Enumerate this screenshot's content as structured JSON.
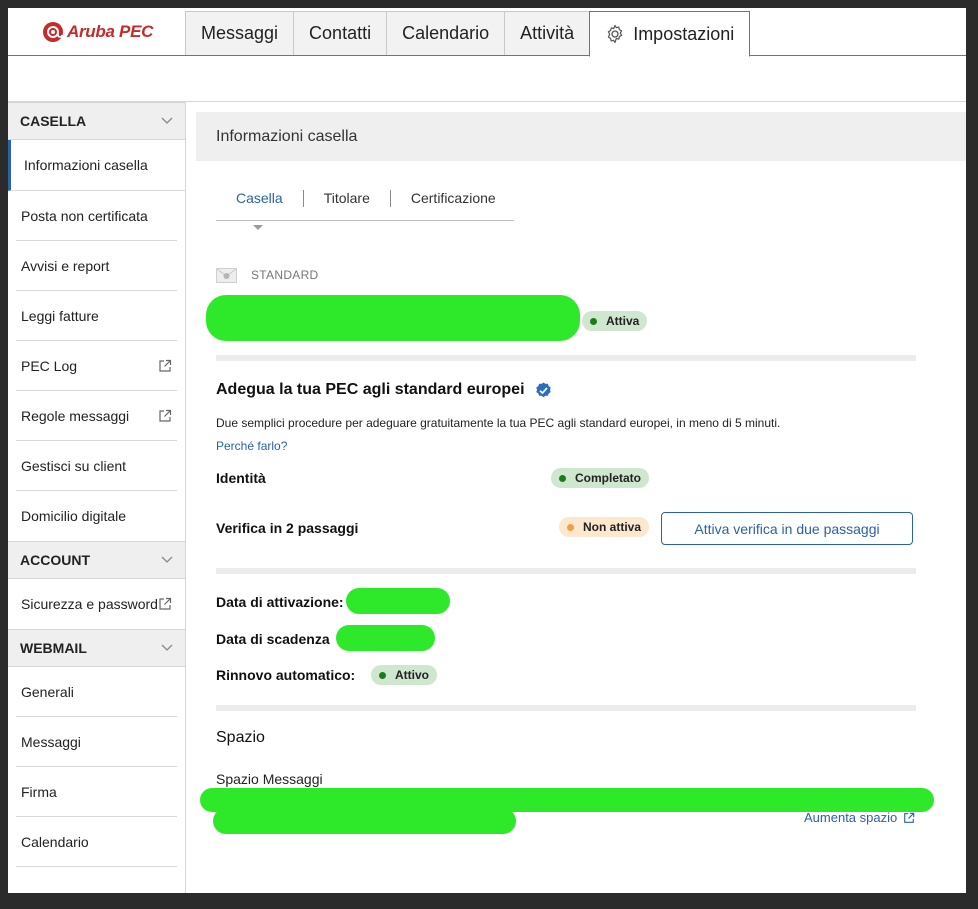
{
  "brand": {
    "name": "Aruba PEC"
  },
  "nav": {
    "tabs": [
      {
        "label": "Messaggi"
      },
      {
        "label": "Contatti"
      },
      {
        "label": "Calendario"
      },
      {
        "label": "Attività"
      },
      {
        "label": "Impostazioni",
        "icon": "gear-icon",
        "active": true
      }
    ]
  },
  "sidebar": {
    "casella": {
      "header": "CASELLA",
      "items": [
        {
          "label": "Informazioni casella",
          "active": true
        },
        {
          "label": "Posta non certificata"
        },
        {
          "label": "Avvisi e report"
        },
        {
          "label": "Leggi fatture"
        },
        {
          "label": "PEC Log",
          "icon": "external-link-icon"
        },
        {
          "label": "Regole messaggi",
          "icon": "external-link-icon"
        },
        {
          "label": "Gestisci su client"
        },
        {
          "label": "Domicilio digitale"
        }
      ]
    },
    "account": {
      "header": "ACCOUNT",
      "items": [
        {
          "label": "Sicurezza e password",
          "icon": "external-link-icon"
        }
      ]
    },
    "webmail": {
      "header": "WEBMAIL",
      "items": [
        {
          "label": "Generali"
        },
        {
          "label": "Messaggi"
        },
        {
          "label": "Firma"
        },
        {
          "label": "Calendario"
        }
      ]
    }
  },
  "main": {
    "header": "Informazioni casella",
    "subtabs": [
      {
        "label": "Casella",
        "active": true
      },
      {
        "label": "Titolare"
      },
      {
        "label": "Certificazione"
      }
    ],
    "mailbox_type": "STANDARD",
    "mailbox_status": "Attiva",
    "eu": {
      "title": "Adegua la tua PEC agli standard europei",
      "description": "Due semplici procedure per adeguare gratuitamente la tua PEC agli standard europei, in meno di 5 minuti.",
      "link": "Perché farlo?",
      "identity_label": "Identità",
      "identity_status": "Completato",
      "twofa_label": "Verifica in 2 passaggi",
      "twofa_status": "Non attiva",
      "twofa_button": "Attiva verifica in due passaggi"
    },
    "details": {
      "activation_label": "Data di attivazione:",
      "expiry_label": "Data di scadenza",
      "renewal_label": "Rinnovo automatico:",
      "renewal_status": "Attivo"
    },
    "space": {
      "title": "Spazio",
      "messages_label": "Spazio Messaggi",
      "increase_link": "Aumenta spazio"
    }
  },
  "colors": {
    "accent": "#2a62a8",
    "brand": "#c62a2a",
    "success": "#1e7a1e",
    "warning": "#f0a040",
    "redaction": "#2ee82a"
  }
}
